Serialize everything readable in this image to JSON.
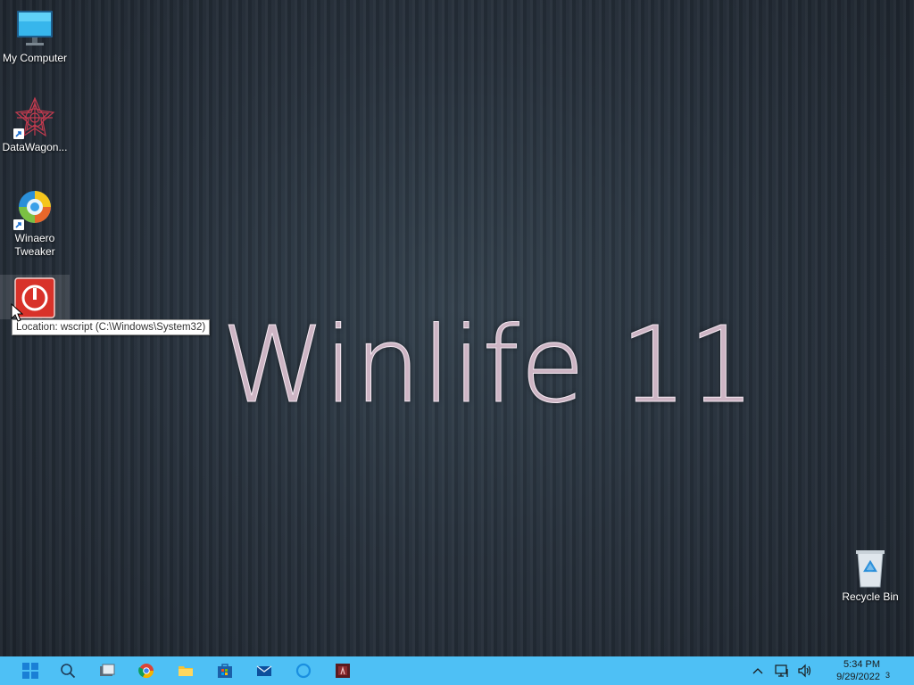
{
  "desktop": {
    "icons": [
      {
        "label": "My Computer",
        "icon": "monitor-icon"
      },
      {
        "label": "DataWagon...",
        "icon": "datawagon-icon"
      },
      {
        "label": "Winaero Tweaker",
        "icon": "winaero-tweaker-icon"
      },
      {
        "label": "",
        "icon": "shutdown-icon"
      }
    ],
    "recycle_bin": {
      "label": "Recycle Bin",
      "icon": "recycle-bin-icon"
    },
    "tooltip": "Location: wscript (C:\\Windows\\System32)",
    "wallpaper_text": "Winlife 11"
  },
  "taskbar": {
    "color": "#4ec0f5",
    "apps": [
      {
        "name": "start",
        "icon": "windows-logo-icon"
      },
      {
        "name": "search",
        "icon": "search-icon"
      },
      {
        "name": "task-view",
        "icon": "task-view-icon"
      },
      {
        "name": "chrome",
        "icon": "chrome-icon"
      },
      {
        "name": "file-explorer",
        "icon": "folder-icon"
      },
      {
        "name": "store",
        "icon": "store-icon"
      },
      {
        "name": "mail",
        "icon": "mail-icon"
      },
      {
        "name": "cortana",
        "icon": "cortana-icon"
      },
      {
        "name": "app",
        "icon": "red-app-icon"
      }
    ],
    "tray": {
      "time": "5:34 PM",
      "date": "9/29/2022",
      "notification_count": "3"
    }
  }
}
